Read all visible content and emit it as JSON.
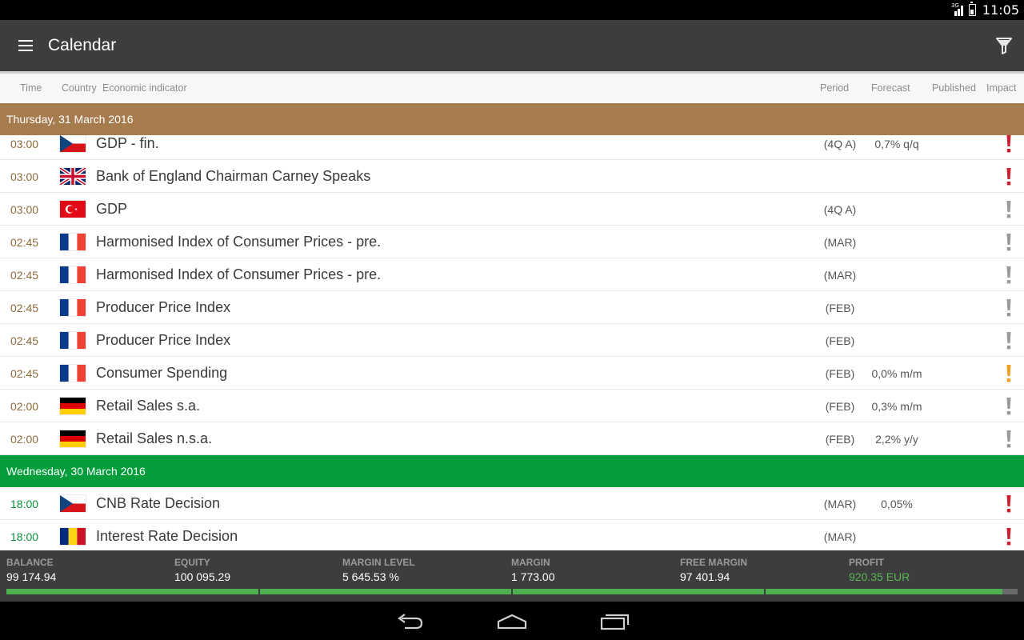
{
  "status_bar": {
    "time": "11:05",
    "network": "3G"
  },
  "app_bar": {
    "title": "Calendar"
  },
  "columns": {
    "time": "Time",
    "country": "Country",
    "indicator": "Economic indicator",
    "period": "Period",
    "forecast": "Forecast",
    "published": "Published",
    "impact": "Impact"
  },
  "colors": {
    "day_thursday": "#a67c4e",
    "day_wednesday": "#049d3c",
    "time_thursday": "#8f6a3c",
    "time_wednesday": "#0a8f3a",
    "impact_high": "#d0202e",
    "impact_medium": "#f0a020",
    "impact_low": "#9a9a9a"
  },
  "days": [
    {
      "label": "Thursday, 31 March 2016",
      "color": "#a67c4e",
      "time_color": "#8f6a3c",
      "events": [
        {
          "time": "03:00",
          "flag": "cz",
          "indicator": "GDP - fin.",
          "period": "(4Q A)",
          "forecast": "0,7% q/q",
          "impact": "high",
          "partial": true
        },
        {
          "time": "03:00",
          "flag": "gb",
          "indicator": "Bank of England Chairman Carney Speaks",
          "period": "",
          "forecast": "",
          "impact": "high"
        },
        {
          "time": "03:00",
          "flag": "tr",
          "indicator": "GDP",
          "period": "(4Q A)",
          "forecast": "",
          "impact": "low"
        },
        {
          "time": "02:45",
          "flag": "fr",
          "indicator": "Harmonised Index of Consumer Prices - pre.",
          "period": "(MAR)",
          "forecast": "",
          "impact": "low"
        },
        {
          "time": "02:45",
          "flag": "fr",
          "indicator": "Harmonised Index of Consumer Prices - pre.",
          "period": "(MAR)",
          "forecast": "",
          "impact": "low"
        },
        {
          "time": "02:45",
          "flag": "fr",
          "indicator": "Producer Price Index",
          "period": "(FEB)",
          "forecast": "",
          "impact": "low"
        },
        {
          "time": "02:45",
          "flag": "fr",
          "indicator": "Producer Price Index",
          "period": "(FEB)",
          "forecast": "",
          "impact": "low"
        },
        {
          "time": "02:45",
          "flag": "fr",
          "indicator": "Consumer Spending",
          "period": "(FEB)",
          "forecast": "0,0% m/m",
          "impact": "medium"
        },
        {
          "time": "02:00",
          "flag": "de",
          "indicator": "Retail Sales s.a.",
          "period": "(FEB)",
          "forecast": "0,3% m/m",
          "impact": "low"
        },
        {
          "time": "02:00",
          "flag": "de",
          "indicator": "Retail Sales n.s.a.",
          "period": "(FEB)",
          "forecast": "2,2% y/y",
          "impact": "low"
        }
      ]
    },
    {
      "label": "Wednesday, 30 March 2016",
      "color": "#049d3c",
      "time_color": "#0a8f3a",
      "events": [
        {
          "time": "18:00",
          "flag": "cz",
          "indicator": "CNB Rate Decision",
          "period": "(MAR)",
          "forecast": "0,05%",
          "impact": "high"
        },
        {
          "time": "18:00",
          "flag": "ro",
          "indicator": "Interest Rate Decision",
          "period": "(MAR)",
          "forecast": "",
          "impact": "high"
        }
      ]
    }
  ],
  "account": {
    "balance_label": "BALANCE",
    "balance": "99 174.94",
    "equity_label": "EQUITY",
    "equity": "100 095.29",
    "margin_level_label": "MARGIN LEVEL",
    "margin_level": "5 645.53 %",
    "margin_label": "MARGIN",
    "margin": "1 773.00",
    "free_margin_label": "FREE MARGIN",
    "free_margin": "97 401.94",
    "profit_label": "PROFIT",
    "profit": "920.35 EUR",
    "margin_bar_fill_fraction": 0.985
  },
  "nav": {
    "back": "back-icon",
    "home": "home-icon",
    "recents": "recents-icon"
  }
}
